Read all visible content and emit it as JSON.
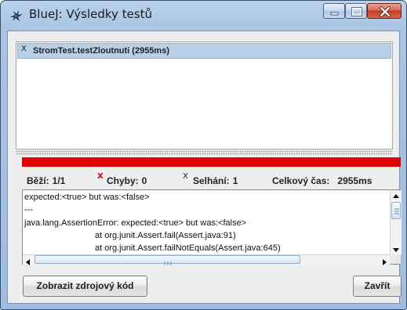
{
  "window": {
    "title": "BlueJ:  Výsledky testů",
    "icon": "bluej-bird-icon"
  },
  "controls": [
    "minimize-icon",
    "maximize-icon",
    "close-icon"
  ],
  "results_list": {
    "items": [
      {
        "label": "StromTest.testZloutnuti (2955ms)",
        "status": "failure",
        "selected": true
      }
    ]
  },
  "progress": {
    "state": "failed",
    "color": "#e00000",
    "fraction": 1.0
  },
  "stats": {
    "runs_label": "Běží:",
    "runs_value": "1/1",
    "errors_label": "Chyby:",
    "errors_value": "0",
    "failures_label": "Selhání:",
    "failures_value": "1",
    "total_time_label": "Celkový čas:",
    "total_time_value": "2955ms"
  },
  "output": {
    "lines": [
      "expected:<true> but was:<false>",
      "---",
      "java.lang.AssertionError: expected:<true> but was:<false>",
      "at org.junit.Assert.fail(Assert.java:91)",
      "at org.junit.Assert.failNotEquals(Assert.java:645)"
    ]
  },
  "buttons": {
    "show_source": "Zobrazit zdrojový kód",
    "close": "Zavřít"
  }
}
